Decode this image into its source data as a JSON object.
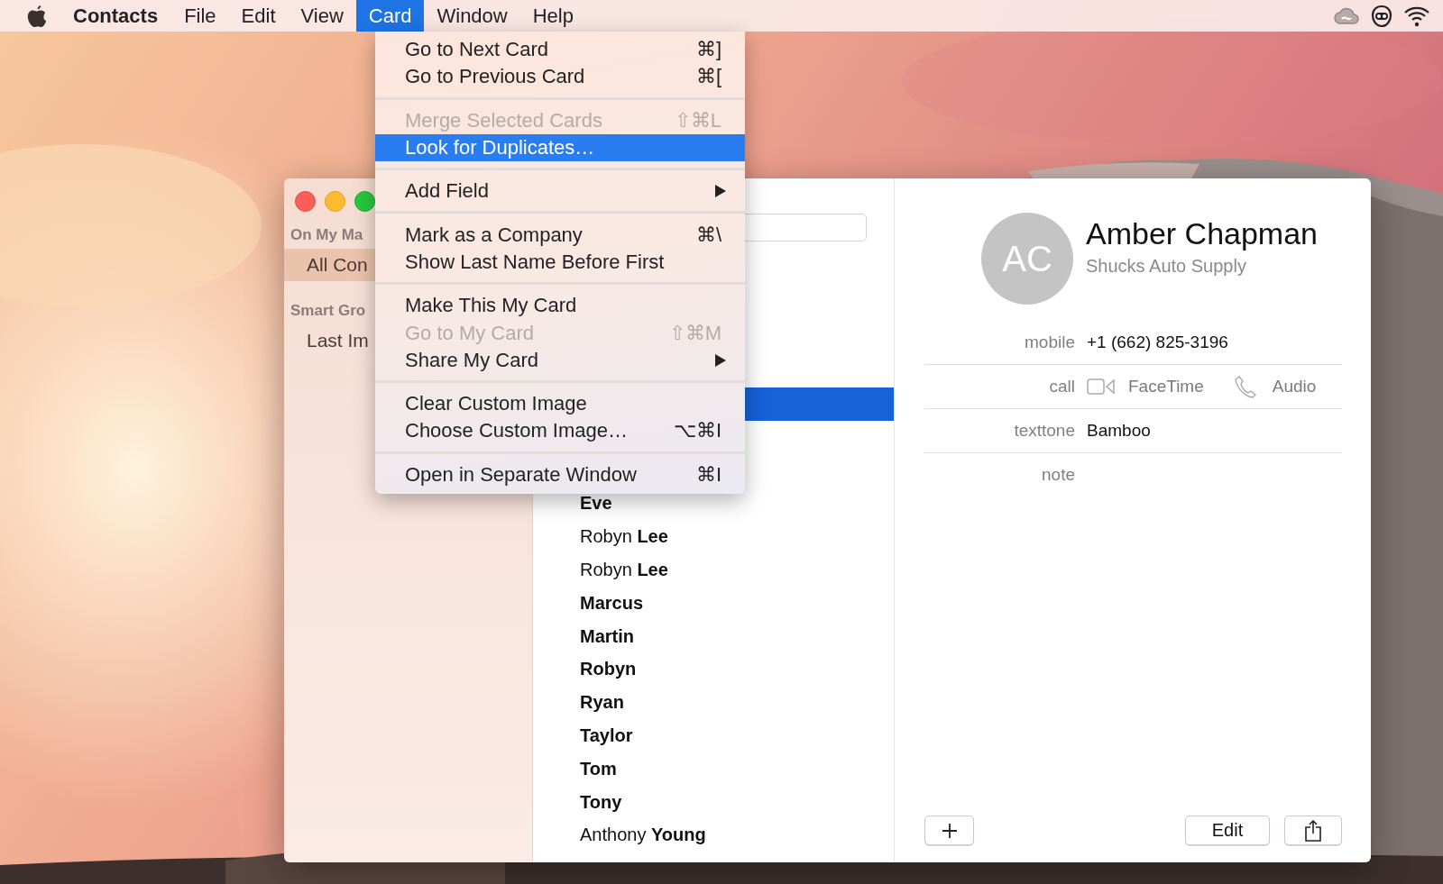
{
  "menu_bar": {
    "app_name": "Contacts",
    "menus": [
      {
        "label": "File",
        "selected": false
      },
      {
        "label": "Edit",
        "selected": false
      },
      {
        "label": "View",
        "selected": false
      },
      {
        "label": "Card",
        "selected": true
      },
      {
        "label": "Window",
        "selected": false
      },
      {
        "label": "Help",
        "selected": false
      }
    ]
  },
  "card_menu": {
    "items": [
      {
        "kind": "item",
        "label": "Go to Next Card",
        "shortcut": "⌘]",
        "disabled": false,
        "selected": false,
        "submenu": false
      },
      {
        "kind": "item",
        "label": "Go to Previous Card",
        "shortcut": "⌘[",
        "disabled": false,
        "selected": false,
        "submenu": false
      },
      {
        "kind": "separator"
      },
      {
        "kind": "item",
        "label": "Merge Selected Cards",
        "shortcut": "⇧⌘L",
        "disabled": true,
        "selected": false,
        "submenu": false
      },
      {
        "kind": "item",
        "label": "Look for Duplicates…",
        "disabled": false,
        "selected": true,
        "submenu": false
      },
      {
        "kind": "separator"
      },
      {
        "kind": "item",
        "label": "Add Field",
        "disabled": false,
        "selected": false,
        "submenu": true
      },
      {
        "kind": "separator"
      },
      {
        "kind": "item",
        "label": "Mark as a Company",
        "shortcut": "⌘\\",
        "disabled": false,
        "selected": false,
        "submenu": false
      },
      {
        "kind": "item",
        "label": "Show Last Name Before First",
        "disabled": false,
        "selected": false,
        "submenu": false
      },
      {
        "kind": "separator"
      },
      {
        "kind": "item",
        "label": "Make This My Card",
        "disabled": false,
        "selected": false,
        "submenu": false
      },
      {
        "kind": "item",
        "label": "Go to My Card",
        "shortcut": "⇧⌘M",
        "disabled": true,
        "selected": false,
        "submenu": false
      },
      {
        "kind": "item",
        "label": "Share My Card",
        "disabled": false,
        "selected": false,
        "submenu": true
      },
      {
        "kind": "separator"
      },
      {
        "kind": "item",
        "label": "Clear Custom Image",
        "disabled": false,
        "selected": false,
        "submenu": false
      },
      {
        "kind": "item",
        "label": "Choose Custom Image…",
        "shortcut": "⌥⌘I",
        "disabled": false,
        "selected": false,
        "submenu": false
      },
      {
        "kind": "separator"
      },
      {
        "kind": "item",
        "label": "Open in Separate Window",
        "shortcut": "⌘I",
        "disabled": false,
        "selected": false,
        "submenu": false
      }
    ]
  },
  "window": {
    "sidebar": {
      "sections": [
        {
          "header": "On My Ma",
          "items": [
            {
              "label": "All Con",
              "selected": true
            }
          ]
        },
        {
          "header": "Smart Gro",
          "items": [
            {
              "label": "Last Im",
              "selected": false
            }
          ]
        }
      ]
    },
    "contacts": [
      {
        "selected": true
      },
      {
        "name": "Eve",
        "kind": "first_only",
        "selected": false
      },
      {
        "name": "Robyn **Lee**",
        "kind": "full",
        "selected": false
      },
      {
        "name": "Robyn **Lee**",
        "kind": "full",
        "selected": false
      },
      {
        "name": "Marcus",
        "kind": "first_only",
        "selected": false
      },
      {
        "name": "Martin",
        "kind": "first_only",
        "selected": false
      },
      {
        "name": "Robyn",
        "kind": "first_only",
        "selected": false
      },
      {
        "name": "Ryan",
        "kind": "first_only",
        "selected": false
      },
      {
        "name": "Taylor",
        "kind": "first_only",
        "selected": false
      },
      {
        "name": "Tom",
        "kind": "first_only",
        "selected": false
      },
      {
        "name": "Tony",
        "kind": "first_only",
        "selected": false
      },
      {
        "name": "Anthony **Young**",
        "kind": "full",
        "selected": false
      }
    ],
    "card": {
      "initials": "AC",
      "name": "Amber Chapman",
      "company": "Shucks Auto Supply",
      "fields": [
        {
          "kind": "text",
          "label": "mobile",
          "value": "+1 (662) 825-3196"
        },
        {
          "kind": "call",
          "label": "call",
          "video": "FaceTime",
          "audio": "Audio"
        },
        {
          "kind": "text",
          "label": "texttone",
          "value": "Bamboo"
        },
        {
          "kind": "empty",
          "label": "note"
        }
      ],
      "edit_button": "Edit"
    }
  }
}
